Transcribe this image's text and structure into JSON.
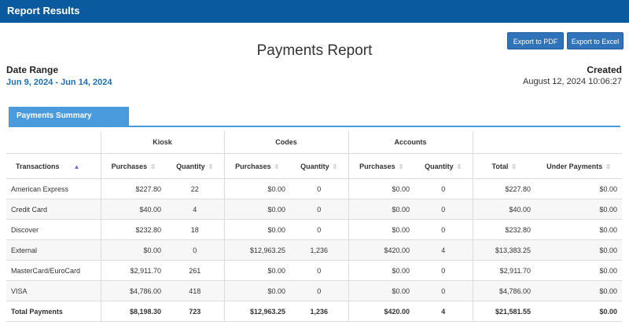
{
  "header": {
    "title": "Report Results"
  },
  "page_title": "Payments Report",
  "buttons": {
    "pdf": "Export to PDF",
    "excel": "Export to Excel"
  },
  "date_range": {
    "label": "Date Range",
    "value": "Jun 9, 2024 - Jun 14, 2024"
  },
  "created": {
    "label": "Created",
    "value": "August 12, 2024 10:06:27"
  },
  "tab": {
    "label": "Payments Summary"
  },
  "table": {
    "groups": {
      "kiosk": "Kiosk",
      "codes": "Codes",
      "accounts": "Accounts"
    },
    "columns": {
      "transactions": "Transactions",
      "purchases": "Purchases",
      "quantity": "Quantity",
      "total": "Total",
      "under": "Under Payments"
    },
    "rows": [
      {
        "name": "American Express",
        "kp": "$227.80",
        "kq": "22",
        "cp": "$0.00",
        "cq": "0",
        "ap": "$0.00",
        "aq": "0",
        "total": "$227.80",
        "under": "$0.00"
      },
      {
        "name": "Credit Card",
        "kp": "$40.00",
        "kq": "4",
        "cp": "$0.00",
        "cq": "0",
        "ap": "$0.00",
        "aq": "0",
        "total": "$40.00",
        "under": "$0.00"
      },
      {
        "name": "Discover",
        "kp": "$232.80",
        "kq": "18",
        "cp": "$0.00",
        "cq": "0",
        "ap": "$0.00",
        "aq": "0",
        "total": "$232.80",
        "under": "$0.00"
      },
      {
        "name": "External",
        "kp": "$0.00",
        "kq": "0",
        "cp": "$12,963.25",
        "cq": "1,236",
        "ap": "$420.00",
        "aq": "4",
        "total": "$13,383.25",
        "under": "$0.00"
      },
      {
        "name": "MasterCard/EuroCard",
        "kp": "$2,911.70",
        "kq": "261",
        "cp": "$0.00",
        "cq": "0",
        "ap": "$0.00",
        "aq": "0",
        "total": "$2,911.70",
        "under": "$0.00"
      },
      {
        "name": "VISA",
        "kp": "$4,786.00",
        "kq": "418",
        "cp": "$0.00",
        "cq": "0",
        "ap": "$0.00",
        "aq": "0",
        "total": "$4,786.00",
        "under": "$0.00"
      }
    ],
    "totals": {
      "name": "Total Payments",
      "kp": "$8,198.30",
      "kq": "723",
      "cp": "$12,963.25",
      "cq": "1,236",
      "ap": "$420.00",
      "aq": "4",
      "total": "$21,581.55",
      "under": "$0.00"
    }
  },
  "colors": {
    "header_bar": "#0a5aa0",
    "tab": "#4a9ade",
    "date_value": "#1f6fb3",
    "button": "#2f73b8"
  }
}
